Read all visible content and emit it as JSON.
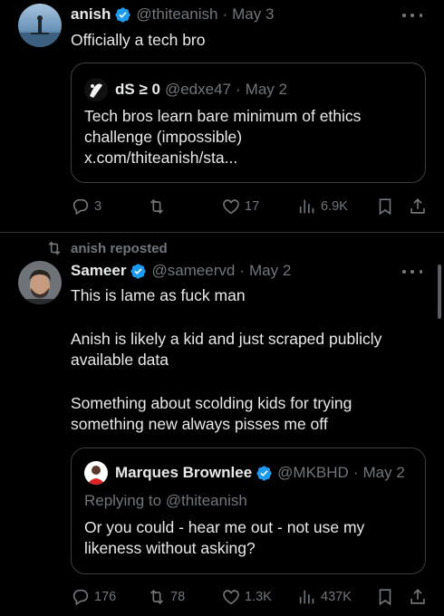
{
  "post1": {
    "author": "anish",
    "handle": "@thiteanish",
    "date": "May 3",
    "text": "Officially a tech bro",
    "quote": {
      "author": "dS ≥ 0",
      "handle": "@edxe47",
      "date": "May 2",
      "text_lines": [
        "Tech bros learn bare minimum of ethics",
        "challenge (impossible)",
        "x.com/thiteanish/sta..."
      ]
    },
    "stats": {
      "replies": "3",
      "reposts": "",
      "likes": "17",
      "views": "6.9K"
    }
  },
  "repost_banner": "anish reposted",
  "post2": {
    "author": "Sameer",
    "handle": "@sameervd",
    "date": "May 2",
    "text_lines": [
      "This is lame as fuck man",
      "",
      "Anish is likely a kid and just scraped publicly",
      "available data",
      "",
      "Something about scolding kids for trying",
      "something new always pisses me off"
    ],
    "quote": {
      "author": "Marques Brownlee",
      "handle": "@MKBHD",
      "date": "May 2",
      "replying_to": "Replying to @thiteanish",
      "text_lines": [
        "Or you could - hear me out - not use my",
        "likeness without asking?"
      ]
    },
    "stats": {
      "replies": "176",
      "reposts": "78",
      "likes": "1.3K",
      "views": "437K"
    }
  },
  "colors": {
    "background": "#000000",
    "text": "#e7e9ea",
    "muted": "#71767b",
    "verified": "#1d9bf0",
    "border": "#2f3336"
  },
  "icons": [
    "verified-badge-icon",
    "more-icon",
    "reply-icon",
    "repost-icon",
    "like-icon",
    "views-icon",
    "bookmark-icon",
    "share-icon"
  ]
}
